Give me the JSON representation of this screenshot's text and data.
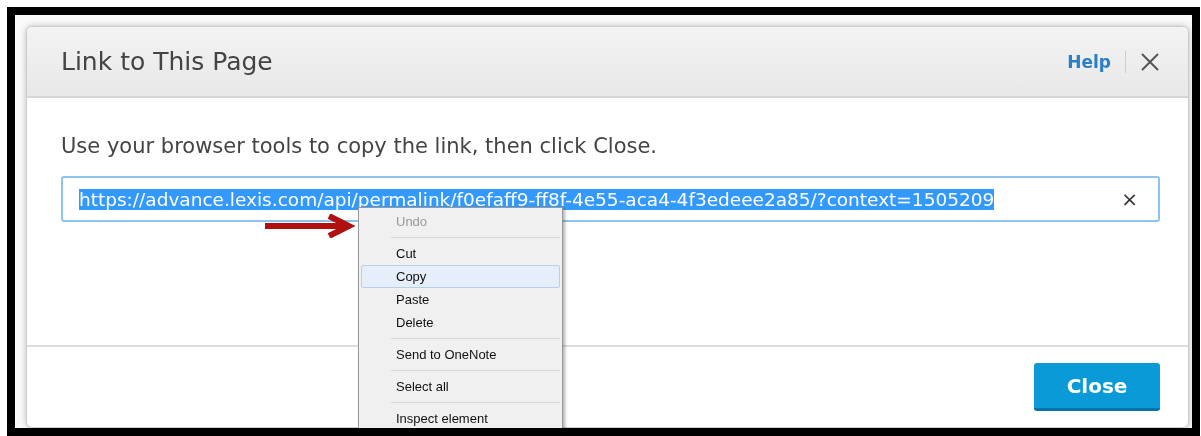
{
  "dialog": {
    "title": "Link to This Page",
    "help_link": "Help",
    "instruction": "Use your browser tools to copy the link, then click Close.",
    "link_field": {
      "value": "https://advance.lexis.com/api/permalink/f0efaff9-ff8f-4e55-aca4-4f3edeee2a85/?context=1505209",
      "selected": true
    },
    "clear_symbol": "×",
    "close_button": "Close"
  },
  "context_menu": {
    "items": [
      {
        "kind": "item",
        "label": "Undo",
        "disabled": true,
        "selected": false
      },
      {
        "kind": "separator"
      },
      {
        "kind": "item",
        "label": "Cut",
        "disabled": false,
        "selected": false
      },
      {
        "kind": "item",
        "label": "Copy",
        "disabled": false,
        "selected": true
      },
      {
        "kind": "item",
        "label": "Paste",
        "disabled": false,
        "selected": false
      },
      {
        "kind": "item",
        "label": "Delete",
        "disabled": false,
        "selected": false
      },
      {
        "kind": "separator"
      },
      {
        "kind": "item",
        "label": "Send to OneNote",
        "disabled": false,
        "selected": false
      },
      {
        "kind": "separator"
      },
      {
        "kind": "item",
        "label": "Select all",
        "disabled": false,
        "selected": false
      },
      {
        "kind": "separator"
      },
      {
        "kind": "item",
        "label": "Inspect element",
        "disabled": false,
        "selected": false
      }
    ]
  }
}
